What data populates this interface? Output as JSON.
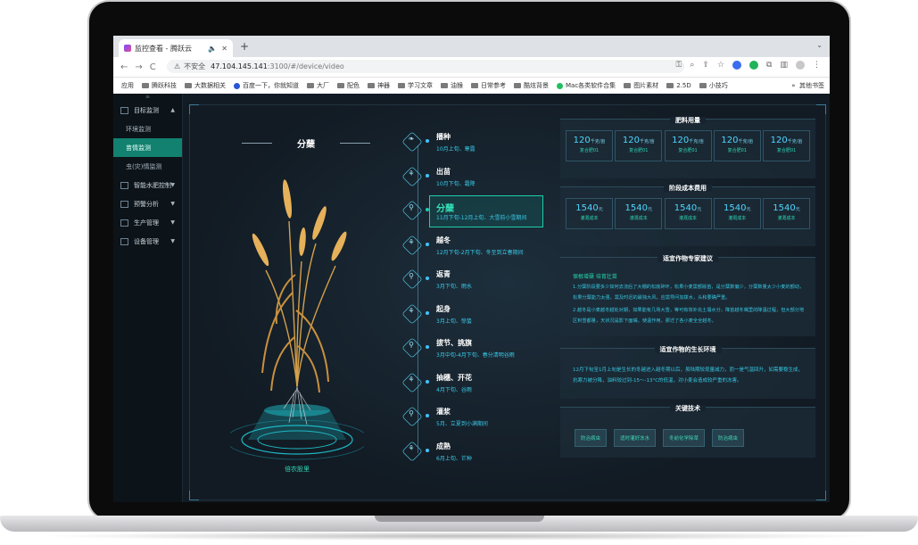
{
  "browser": {
    "tab_title": "监控查看 - 腾跃云",
    "audio_icon": "speaker-icon",
    "new_tab": "+",
    "nav_back": "←",
    "nav_forward": "→",
    "nav_reload": "C",
    "insecure_label": "不安全",
    "url_host": "47.104.145.141",
    "url_path": ":3100/#/device/video",
    "bookmarks": [
      "应用",
      "腾跃科技",
      "大数据相关",
      "百度一下，你就知道",
      "大厂",
      "配色",
      "神器",
      "学习文章",
      "油猴",
      "日常参考",
      "酷炫背景",
      "Mac各类软件合集",
      "图片素材",
      "2.5D",
      "小技巧"
    ],
    "bookmarks_more": "»",
    "bookmarks_other": "其他书签"
  },
  "sidebar": {
    "toggle": "≡",
    "groups": [
      {
        "label": "目标监测",
        "arrow": "▲"
      },
      {
        "label": "智能水肥控制",
        "arrow": "▼"
      },
      {
        "label": "预警分析",
        "arrow": "▼"
      },
      {
        "label": "生产管理",
        "arrow": "▼"
      },
      {
        "label": "设备管理",
        "arrow": "▼"
      }
    ],
    "sub_items": [
      "环境监测",
      "苗情监测",
      "虫(灾)情监测"
    ]
  },
  "crop": {
    "title": "分蘖",
    "variety": "倍农股里"
  },
  "stages": [
    {
      "name": "播种",
      "desc": "10月上旬、寒露"
    },
    {
      "name": "出苗",
      "desc": "10月下旬、霜降"
    },
    {
      "name": "分蘖",
      "desc": "11月下旬-12月上旬、大雪前小雪期间"
    },
    {
      "name": "越冬",
      "desc": "12月下旬-2月下旬、冬至到立春期间"
    },
    {
      "name": "返青",
      "desc": "3月下旬、雨水"
    },
    {
      "name": "起身",
      "desc": "3月上旬、惊蛰"
    },
    {
      "name": "拔节、挑旗",
      "desc": "3月中旬-4月下旬、春分清明谷雨"
    },
    {
      "name": "抽穗、开花",
      "desc": "4月下旬、谷雨"
    },
    {
      "name": "灌浆",
      "desc": "5月、立夏到小满期间"
    },
    {
      "name": "成熟",
      "desc": "6月上旬、芒种"
    }
  ],
  "active_stage": 2,
  "fertilizer": {
    "title": "肥料用量",
    "unit": "千克/亩",
    "cards": [
      {
        "value": "120",
        "label": "复合肥01"
      },
      {
        "value": "120",
        "label": "复合肥01"
      },
      {
        "value": "120",
        "label": "复合肥01"
      },
      {
        "value": "120",
        "label": "复合肥01"
      },
      {
        "value": "120",
        "label": "复合肥01"
      }
    ]
  },
  "cost": {
    "title": "阶段成本费用",
    "unit": "元",
    "cards": [
      {
        "value": "1540",
        "label": "灌溉成本"
      },
      {
        "value": "1540",
        "label": "灌溉成本"
      },
      {
        "value": "1540",
        "label": "灌溉成本"
      },
      {
        "value": "1540",
        "label": "灌溉成本"
      },
      {
        "value": "1540",
        "label": "灌溉成本"
      }
    ]
  },
  "advice": {
    "title": "适宜作物专家建议",
    "head": "保根增蘖 培育壮苗",
    "p1": "1.分蘖阶段要多少如何去浇后了大棚的松底碎环，松果小麦需额版苗，是分蘖数偏少，分蘖数量太少小麦的额动，松果分蘖能力太强，需及时迟的最独大风，应需导问加拨水，头和要确严重。",
    "p2": "2.越冬是小麦越冬越处对期，如果能有几场大雪，等可有效补充土壤水分，降苗越冬嘴里的降温过程，但大部分地区积雪都量，天状况是影下面嘴，使温作用，那迁了各小麦全全越冬。"
  },
  "environment": {
    "title": "适宜作物的生长环境",
    "text": "12月下旬至1月上旬是生长的冬越进入越冬期以后，虽陆期较现量减力，而一是气温回升，如需要稳生成，抗寒力被分降，油料较过到-15～-13°C的低温，对小麦会造成较严重的冻害。"
  },
  "tech": {
    "title": "关键技术",
    "tags": [
      "防治病虫",
      "适时灌好冻水",
      "冬前化学除草",
      "防治病虫"
    ]
  }
}
